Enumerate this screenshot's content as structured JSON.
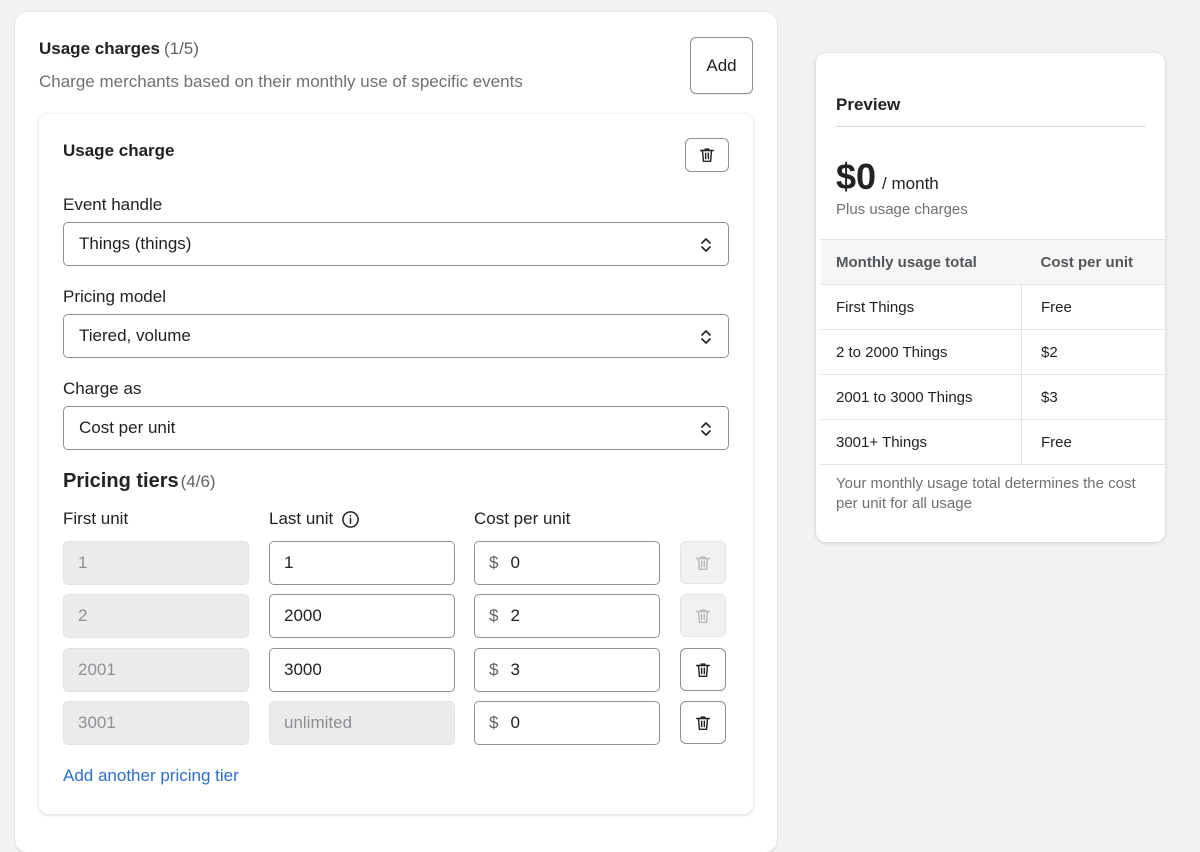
{
  "usage": {
    "title": "Usage charges",
    "count": "(1/5)",
    "subtitle": "Charge merchants based on their monthly use of specific events",
    "add_label": "Add"
  },
  "charge": {
    "title": "Usage charge",
    "event_label": "Event handle",
    "event_value": "Things (things)",
    "model_label": "Pricing model",
    "model_value": "Tiered, volume",
    "charge_as_label": "Charge as",
    "charge_as_value": "Cost per unit"
  },
  "tiers": {
    "title": "Pricing tiers",
    "count": "(4/6)",
    "col_first": "First unit",
    "col_last": "Last unit",
    "col_cost": "Cost per unit",
    "currency": "$",
    "rows": [
      {
        "first": "1",
        "last": "1",
        "cost": "0"
      },
      {
        "first": "2",
        "last": "2000",
        "cost": "2"
      },
      {
        "first": "2001",
        "last": "3000",
        "cost": "3"
      },
      {
        "first": "3001",
        "last": "unlimited",
        "cost": "0"
      }
    ],
    "add_link": "Add another pricing tier"
  },
  "preview": {
    "title": "Preview",
    "amount": "$0",
    "period": "/ month",
    "sub": "Plus usage charges",
    "col_usage": "Monthly usage total",
    "col_cost": "Cost per unit",
    "rows": [
      {
        "usage": "First Things",
        "cost": "Free"
      },
      {
        "usage": "2 to 2000 Things",
        "cost": "$2"
      },
      {
        "usage": "2001 to 3000 Things",
        "cost": "$3"
      },
      {
        "usage": "3001+ Things",
        "cost": "Free"
      }
    ],
    "note": "Your monthly usage total determines the cost per unit for all usage"
  },
  "colors": {
    "link": "#2c6ecb",
    "page_bg": "#f1f2f4",
    "border": "#8c9196"
  },
  "icons": [
    "trash-icon",
    "select-chevron-icon",
    "info-icon"
  ]
}
